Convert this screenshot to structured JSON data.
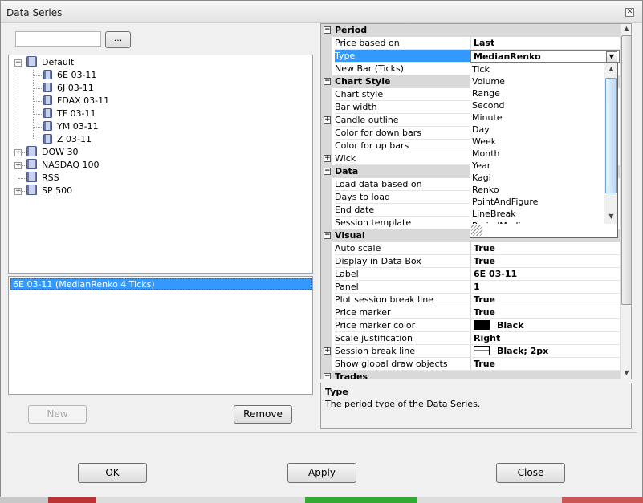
{
  "window": {
    "title": "Data Series"
  },
  "search": {
    "value": "",
    "button_label": "..."
  },
  "tree": {
    "root": "Default",
    "children": [
      "6E 03-11",
      "6J 03-11",
      "FDAX 03-11",
      "TF 03-11",
      "YM 03-11",
      "Z 03-11"
    ],
    "lists": [
      {
        "label": "DOW 30",
        "expandable": true
      },
      {
        "label": "NASDAQ 100",
        "expandable": true
      },
      {
        "label": "RSS",
        "expandable": false
      },
      {
        "label": "SP 500",
        "expandable": true
      }
    ]
  },
  "series_list": {
    "items": [
      "6E 03-11 (MedianRenko 4 Ticks)"
    ]
  },
  "buttons": {
    "new": "New",
    "remove": "Remove",
    "ok": "OK",
    "apply": "Apply",
    "close": "Close"
  },
  "grid": {
    "period": {
      "title": "Period",
      "price_based_on": {
        "label": "Price based on",
        "value": "Last"
      },
      "type": {
        "label": "Type",
        "value": "MedianRenko"
      },
      "new_bar": {
        "label": "New Bar (Ticks)"
      }
    },
    "chart_style": {
      "title": "Chart Style",
      "rows": [
        "Chart style",
        "Bar width",
        "Candle outline",
        "Color for down bars",
        "Color for up bars",
        "Wick"
      ]
    },
    "data": {
      "title": "Data",
      "rows": [
        "Load data based on",
        "Days to load",
        "End date",
        "Session template"
      ]
    },
    "visual": {
      "title": "Visual",
      "rows": [
        {
          "label": "Auto scale",
          "value": "True"
        },
        {
          "label": "Display in Data Box",
          "value": "True"
        },
        {
          "label": "Label",
          "value": "6E 03-11"
        },
        {
          "label": "Panel",
          "value": "1"
        },
        {
          "label": "Plot session break line",
          "value": "True"
        },
        {
          "label": "Price marker",
          "value": "True"
        },
        {
          "label": "Price marker color",
          "value": "Black"
        },
        {
          "label": "Scale justification",
          "value": "Right"
        },
        {
          "label": "Session break line",
          "value": "Black; 2px"
        },
        {
          "label": "Show global draw objects",
          "value": "True"
        }
      ]
    },
    "trades": {
      "title": "Trades"
    }
  },
  "type_dropdown": {
    "options": [
      "Tick",
      "Volume",
      "Range",
      "Second",
      "Minute",
      "Day",
      "Week",
      "Month",
      "Year",
      "Kagi",
      "Renko",
      "PointAndFigure",
      "LineBreak"
    ],
    "partial": "PeriodMedi"
  },
  "help": {
    "title": "Type",
    "description": "The period type of the Data Series."
  },
  "colors": {
    "selection": "#3399ff",
    "category": "#d9d9d9",
    "marker_color": "#000000"
  }
}
